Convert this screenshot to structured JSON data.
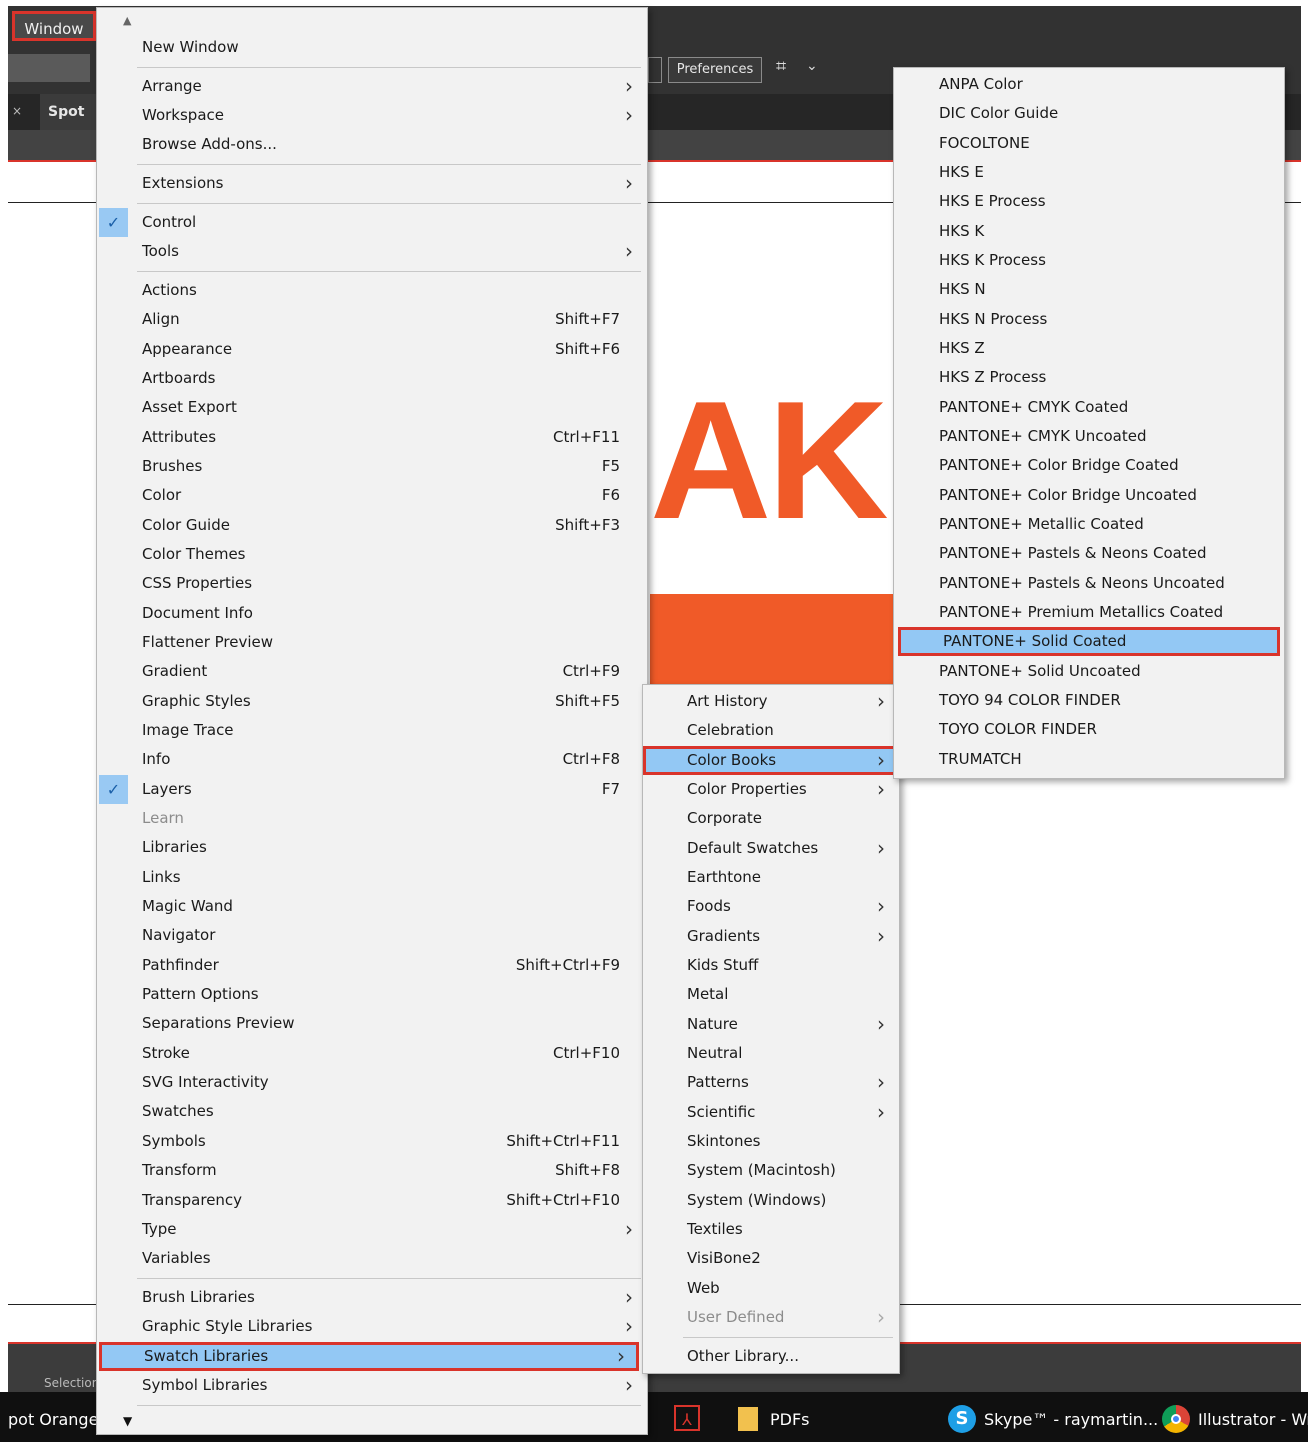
{
  "app": {
    "window_menu_label": "Window",
    "preferences_label": "Preferences",
    "tab_label": "Spot O",
    "tab_close": "×",
    "status_label": "Selection",
    "art_text": "AKE"
  },
  "taskbar": {
    "spot_label": "pot Orange",
    "pdfs_label": "PDFs",
    "skype_label": "Skype™ - raymartin...",
    "illustrator_label": "Illustrator - Wr"
  },
  "main_menu": {
    "items": [
      {
        "label": "New Window"
      },
      {
        "label": "Arrange",
        "submenu": true
      },
      {
        "label": "Workspace",
        "submenu": true
      },
      {
        "label": "Browse Add-ons..."
      },
      {
        "label": "Extensions",
        "submenu": true
      },
      {
        "label": "Control",
        "checked": true
      },
      {
        "label": "Tools",
        "submenu": true
      },
      {
        "label": "Actions"
      },
      {
        "label": "Align",
        "shortcut": "Shift+F7"
      },
      {
        "label": "Appearance",
        "shortcut": "Shift+F6"
      },
      {
        "label": "Artboards"
      },
      {
        "label": "Asset Export"
      },
      {
        "label": "Attributes",
        "shortcut": "Ctrl+F11"
      },
      {
        "label": "Brushes",
        "shortcut": "F5"
      },
      {
        "label": "Color",
        "shortcut": "F6"
      },
      {
        "label": "Color Guide",
        "shortcut": "Shift+F3"
      },
      {
        "label": "Color Themes"
      },
      {
        "label": "CSS Properties"
      },
      {
        "label": "Document Info"
      },
      {
        "label": "Flattener Preview"
      },
      {
        "label": "Gradient",
        "shortcut": "Ctrl+F9"
      },
      {
        "label": "Graphic Styles",
        "shortcut": "Shift+F5"
      },
      {
        "label": "Image Trace"
      },
      {
        "label": "Info",
        "shortcut": "Ctrl+F8"
      },
      {
        "label": "Layers",
        "shortcut": "F7",
        "checked": true
      },
      {
        "label": "Learn",
        "disabled": true
      },
      {
        "label": "Libraries"
      },
      {
        "label": "Links"
      },
      {
        "label": "Magic Wand"
      },
      {
        "label": "Navigator"
      },
      {
        "label": "Pathfinder",
        "shortcut": "Shift+Ctrl+F9"
      },
      {
        "label": "Pattern Options"
      },
      {
        "label": "Separations Preview"
      },
      {
        "label": "Stroke",
        "shortcut": "Ctrl+F10"
      },
      {
        "label": "SVG Interactivity"
      },
      {
        "label": "Swatches"
      },
      {
        "label": "Symbols",
        "shortcut": "Shift+Ctrl+F11"
      },
      {
        "label": "Transform",
        "shortcut": "Shift+F8"
      },
      {
        "label": "Transparency",
        "shortcut": "Shift+Ctrl+F10"
      },
      {
        "label": "Type",
        "submenu": true
      },
      {
        "label": "Variables"
      },
      {
        "label": "Brush Libraries",
        "submenu": true
      },
      {
        "label": "Graphic Style Libraries",
        "submenu": true
      },
      {
        "label": "Swatch Libraries",
        "submenu": true,
        "highlighted": true
      },
      {
        "label": "Symbol Libraries",
        "submenu": true
      }
    ]
  },
  "library_menu": {
    "items": [
      {
        "label": "Art History",
        "submenu": true
      },
      {
        "label": "Celebration"
      },
      {
        "label": "Color Books",
        "submenu": true,
        "highlighted": true
      },
      {
        "label": "Color Properties",
        "submenu": true
      },
      {
        "label": "Corporate"
      },
      {
        "label": "Default Swatches",
        "submenu": true
      },
      {
        "label": "Earthtone"
      },
      {
        "label": "Foods",
        "submenu": true
      },
      {
        "label": "Gradients",
        "submenu": true
      },
      {
        "label": "Kids Stuff"
      },
      {
        "label": "Metal"
      },
      {
        "label": "Nature",
        "submenu": true
      },
      {
        "label": "Neutral"
      },
      {
        "label": "Patterns",
        "submenu": true
      },
      {
        "label": "Scientific",
        "submenu": true
      },
      {
        "label": "Skintones"
      },
      {
        "label": "System (Macintosh)"
      },
      {
        "label": "System (Windows)"
      },
      {
        "label": "Textiles"
      },
      {
        "label": "VisiBone2"
      },
      {
        "label": "Web"
      },
      {
        "label": "User Defined",
        "submenu": true,
        "disabled": true
      },
      {
        "label": "Other Library..."
      }
    ]
  },
  "colorbooks_menu": {
    "items": [
      {
        "label": "ANPA Color"
      },
      {
        "label": "DIC Color Guide"
      },
      {
        "label": "FOCOLTONE"
      },
      {
        "label": "HKS E"
      },
      {
        "label": "HKS E Process"
      },
      {
        "label": "HKS K"
      },
      {
        "label": "HKS K Process"
      },
      {
        "label": "HKS N"
      },
      {
        "label": "HKS N Process"
      },
      {
        "label": "HKS Z"
      },
      {
        "label": "HKS Z Process"
      },
      {
        "label": "PANTONE+ CMYK Coated"
      },
      {
        "label": "PANTONE+ CMYK Uncoated"
      },
      {
        "label": "PANTONE+ Color Bridge Coated"
      },
      {
        "label": "PANTONE+ Color Bridge Uncoated"
      },
      {
        "label": "PANTONE+ Metallic Coated"
      },
      {
        "label": "PANTONE+ Pastels & Neons Coated"
      },
      {
        "label": "PANTONE+ Pastels & Neons Uncoated"
      },
      {
        "label": "PANTONE+ Premium Metallics Coated"
      },
      {
        "label": "PANTONE+ Solid Coated",
        "highlighted": true
      },
      {
        "label": "PANTONE+ Solid Uncoated"
      },
      {
        "label": "TOYO 94 COLOR FINDER"
      },
      {
        "label": "TOYO COLOR FINDER"
      },
      {
        "label": "TRUMATCH"
      }
    ]
  },
  "colors": {
    "highlight": "#93c8f4",
    "annotation_red": "#d9342b",
    "art_orange": "#f05a28"
  }
}
